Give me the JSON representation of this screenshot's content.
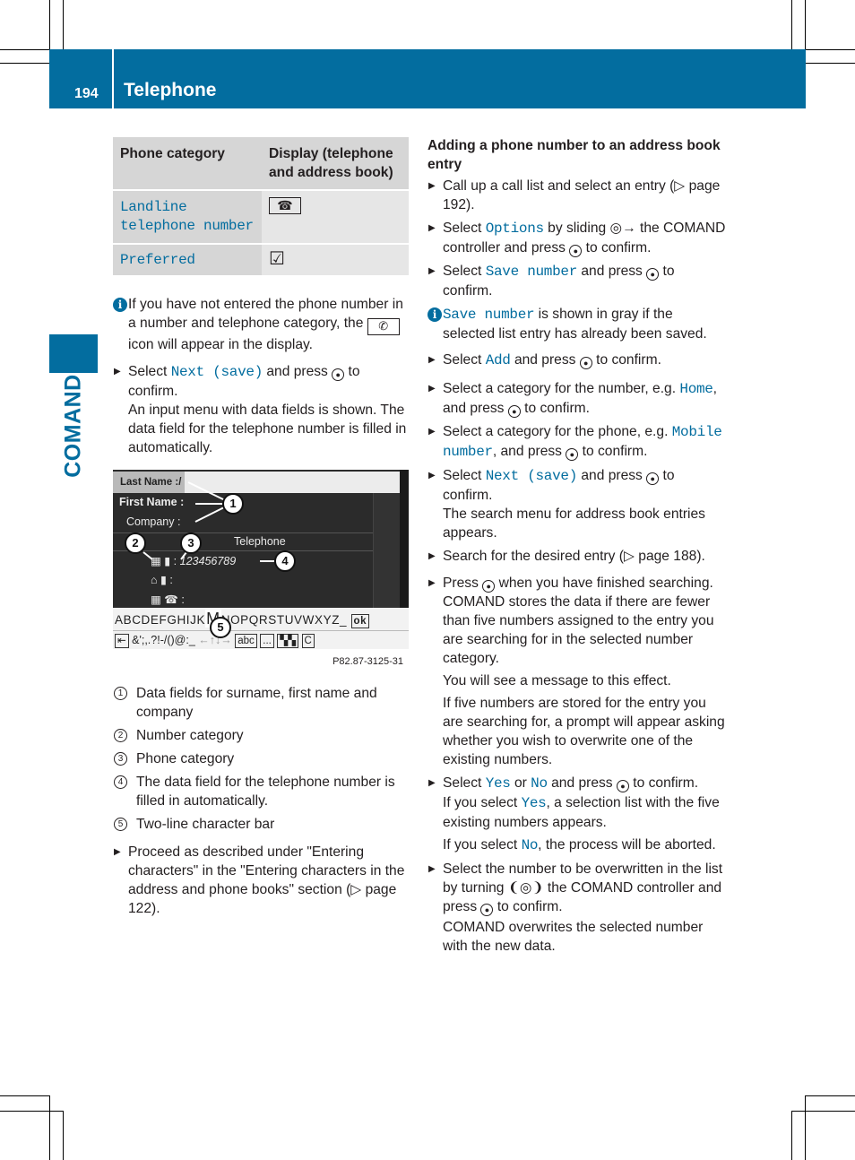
{
  "header": {
    "page_number": "194",
    "section_title": "Telephone",
    "side_tab": "COMAND",
    "brand_color": "#036d9f"
  },
  "table": {
    "headers": [
      "Phone category",
      "Display (telephone and address book)"
    ],
    "rows": [
      {
        "category": "Landline telephone number",
        "display_icon": "landline-phone-icon",
        "display_glyph": "☎"
      },
      {
        "category": "Preferred",
        "display_icon": "checkbox-checked-icon",
        "display_glyph": "☑"
      }
    ]
  },
  "left": {
    "info_note": {
      "icon": "info-icon",
      "text_before": "If you have not entered the phone number in a number and telephone category, the",
      "icon_glyph": "✆",
      "icon_name": "handset-icon",
      "text_after": "icon will appear in the display."
    },
    "step1": {
      "pre": "Select",
      "ui": "Next (save)",
      "post": "and press",
      "post2": "to confirm.",
      "sub": "An input menu with data fields is shown. The data field for the telephone number is filled in automatically."
    },
    "figure": {
      "last_name_label": "Last Name :",
      "last_name_value": "/",
      "first_name_label": "First Name :",
      "company_label": "Company :",
      "telephone_heading": "Telephone",
      "phone_number": "123456789",
      "row_suffix": ":",
      "keys_row1": "ABCDEFGHIJK",
      "keys_row1_highlight": "M",
      "keys_row1_rest": "NOPQRSTUVWXYZ_",
      "ok_key": "ok",
      "keys_row2": "&';,.?!-/()@:_",
      "arrows": "←↑↓→",
      "abc_key": "abc",
      "dots_key": "...",
      "c_key": "C",
      "callouts": [
        "1",
        "2",
        "3",
        "4",
        "5"
      ],
      "caption": "P82.87-3125-31"
    },
    "legend": [
      {
        "num": "1",
        "text": "Data fields for surname, first name and company"
      },
      {
        "num": "2",
        "text": "Number category"
      },
      {
        "num": "3",
        "text": "Phone category"
      },
      {
        "num": "4",
        "text": "The data field for the telephone number is filled in automatically."
      },
      {
        "num": "5",
        "text": "Two-line character bar"
      }
    ],
    "step2": {
      "text": "Proceed as described under \"Entering characters\" in the \"Entering characters in the address and phone books\" section (▷ page 122)."
    }
  },
  "right": {
    "heading": "Adding a phone number to an address book entry",
    "steps": [
      {
        "text": "Call up a call list and select an entry (▷ page 192)."
      },
      {
        "pre": "Select",
        "ui": "Options",
        "mid": "by sliding ◎→ the COMAND controller and press",
        "post": "to confirm."
      },
      {
        "pre": "Select",
        "ui": "Save number",
        "mid": "and press",
        "post": "to confirm."
      }
    ],
    "info": {
      "ui": "Save number",
      "text": "is shown in gray if the selected list entry has already been saved."
    },
    "steps2": [
      {
        "pre": "Select",
        "ui": "Add",
        "mid": "and press",
        "post": "to confirm."
      },
      {
        "pre": "Select a category for the number, e.g.",
        "ui": "Home",
        "mid": ", and press",
        "post": "to confirm."
      },
      {
        "pre": "Select a category for the phone, e.g.",
        "ui": "Mobile number",
        "mid": ", and press",
        "post": "to confirm."
      },
      {
        "pre": "Select",
        "ui": "Next (save)",
        "mid": "and press",
        "post": "to confirm.",
        "sub": "The search menu for address book entries appears."
      },
      {
        "text": "Search for the desired entry (▷ page 188)."
      }
    ],
    "press_step": {
      "pre": "Press",
      "post": "when you have finished searching.",
      "sub1": "COMAND stores the data if there are fewer than five numbers assigned to the entry you are searching for in the selected number category.",
      "sub2": "You will see a message to this effect.",
      "sub3": "If five numbers are stored for the entry you are searching for, a prompt will appear asking whether you wish to overwrite one of the existing numbers."
    },
    "yes_no_step": {
      "pre": "Select",
      "yes": "Yes",
      "or": "or",
      "no": "No",
      "mid": "and press",
      "post": "to confirm.",
      "sub_pre": "If you select",
      "sub_post": ", a selection list with the five existing numbers appears.",
      "sub2_pre": "If you select",
      "sub2_post": ", the process will be aborted."
    },
    "overwrite_step": {
      "pre": "Select the number to be overwritten in the list by turning",
      "turn_glyph": "❨◎❩",
      "mid": "the COMAND controller and press",
      "post": "to confirm.",
      "sub": "COMAND overwrites the selected number with the new data."
    }
  }
}
